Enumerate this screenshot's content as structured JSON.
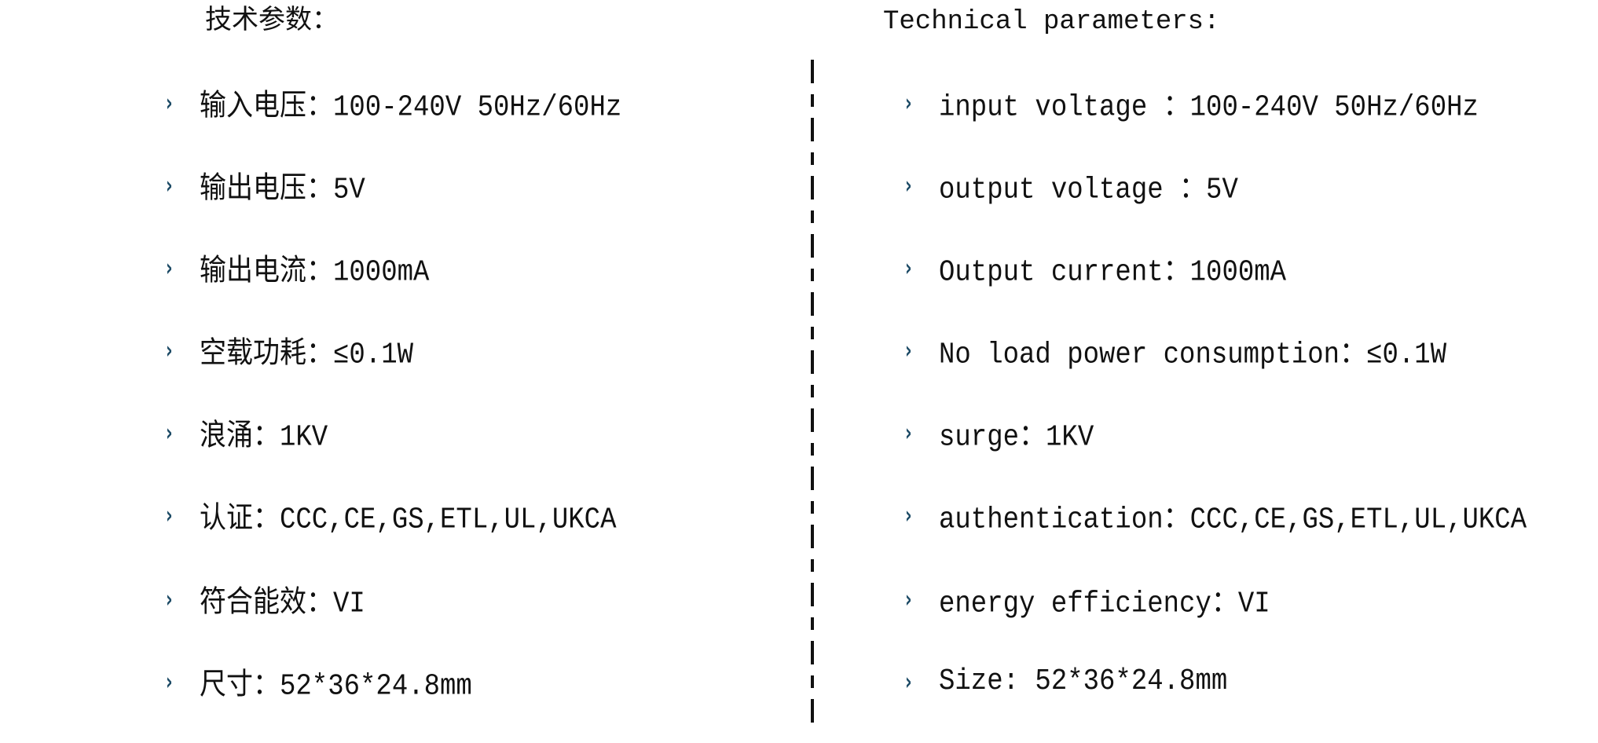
{
  "left": {
    "title": "技术参数：",
    "items": [
      "输入电压：100-240V 50Hz/60Hz",
      "输出电压：5V",
      "输出电流：1000mA",
      "空载功耗：≤0.1W",
      "浪涌：1KV",
      "认证：CCC,CE,GS,ETL,UL,UKCA",
      "符合能效：VI",
      "尺寸：52*36*24.8mm"
    ]
  },
  "right": {
    "title": "Technical parameters:",
    "items": [
      "input voltage ：100-240V 50Hz/60Hz",
      "output voltage ：5V",
      "Output current：1000mA",
      "No load power consumption：≤0.1W",
      "surge：1KV",
      "authentication：CCC,CE,GS,ETL,UL,UKCA",
      "energy efficiency：VI",
      "Size: 52*36*24.8mm"
    ]
  },
  "bullet_icon": "chevron-right-icon",
  "colors": {
    "bullet": "#1d4b66",
    "text": "#111111"
  }
}
